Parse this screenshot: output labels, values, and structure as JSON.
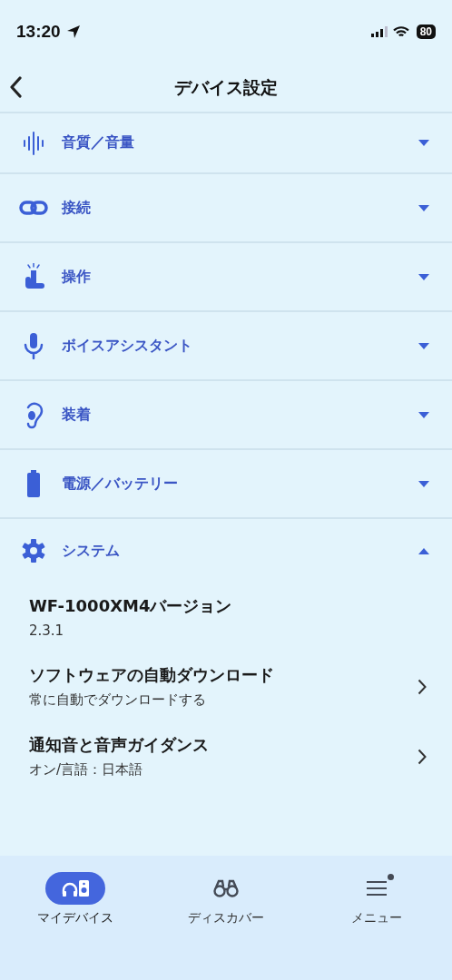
{
  "status_bar": {
    "time": "13:20",
    "battery": "80"
  },
  "nav": {
    "title": "デバイス設定"
  },
  "sections": [
    {
      "label": "音質／音量",
      "expanded": false
    },
    {
      "label": "接続",
      "expanded": false
    },
    {
      "label": "操作",
      "expanded": false
    },
    {
      "label": "ボイスアシスタント",
      "expanded": false
    },
    {
      "label": "装着",
      "expanded": false
    },
    {
      "label": "電源／バッテリー",
      "expanded": false
    },
    {
      "label": "システム",
      "expanded": true,
      "items": [
        {
          "title": "WF-1000XM4バージョン",
          "value": "2.3.1",
          "kind": "info"
        },
        {
          "title": "ソフトウェアの自動ダウンロード",
          "value": "常に自動でダウンロードする",
          "kind": "link"
        },
        {
          "title": "通知音と音声ガイダンス",
          "value": "オン/言語：日本語",
          "kind": "link"
        }
      ]
    }
  ],
  "tabs": [
    {
      "label": "マイデバイス",
      "selected": true,
      "badge": false
    },
    {
      "label": "ディスカバー",
      "selected": false,
      "badge": false
    },
    {
      "label": "メニュー",
      "selected": false,
      "badge": true
    }
  ]
}
